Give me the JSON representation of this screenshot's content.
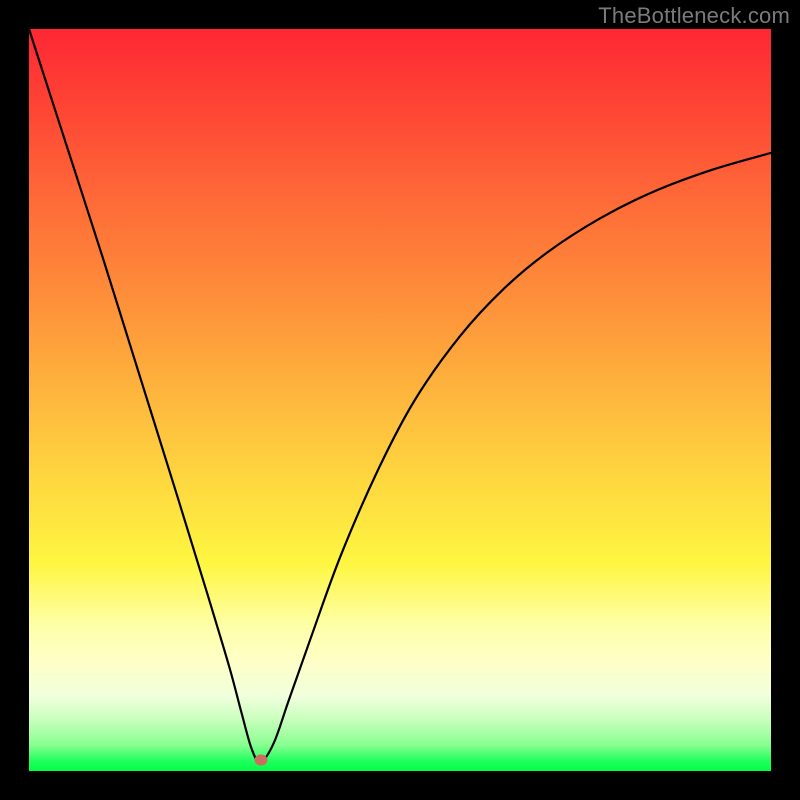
{
  "watermark": "TheBottleneck.com",
  "marker": {
    "x_frac": 0.312,
    "y_frac": 0.985
  },
  "chart_data": {
    "type": "line",
    "title": "",
    "xlabel": "",
    "ylabel": "",
    "xlim": [
      0,
      1
    ],
    "ylim": [
      0,
      1
    ],
    "series": [
      {
        "name": "bottleneck-curve",
        "x": [
          0.0,
          0.05,
          0.1,
          0.15,
          0.2,
          0.24,
          0.27,
          0.286,
          0.3,
          0.312,
          0.33,
          0.35,
          0.38,
          0.42,
          0.47,
          0.52,
          0.58,
          0.64,
          0.7,
          0.77,
          0.84,
          0.92,
          1.0
        ],
        "y": [
          1.0,
          0.845,
          0.69,
          0.53,
          0.37,
          0.24,
          0.14,
          0.08,
          0.03,
          0.012,
          0.038,
          0.095,
          0.18,
          0.29,
          0.405,
          0.5,
          0.585,
          0.65,
          0.7,
          0.745,
          0.78,
          0.81,
          0.833
        ]
      }
    ],
    "marker_point": {
      "x": 0.312,
      "y": 0.015
    },
    "grid": false,
    "legend": false
  }
}
